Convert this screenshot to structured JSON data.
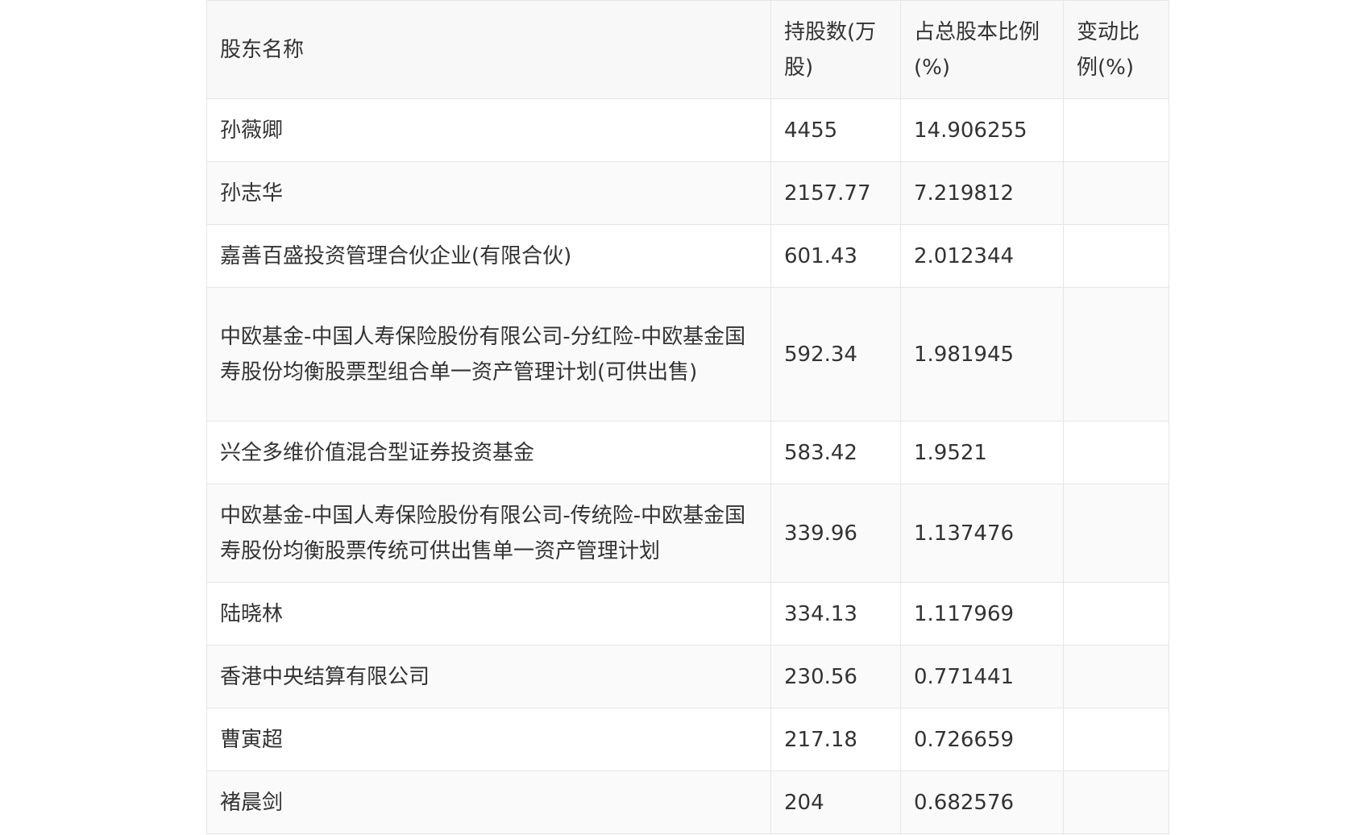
{
  "table": {
    "headers": {
      "name": "股东名称",
      "shares": "持股数(万股)",
      "ratio": "占总股本比例(%)",
      "change": "变动比例(%)"
    },
    "rows": [
      {
        "name": "孙薇卿",
        "shares": "4455",
        "ratio": "14.906255",
        "change": ""
      },
      {
        "name": "孙志华",
        "shares": "2157.77",
        "ratio": "7.219812",
        "change": ""
      },
      {
        "name": "嘉善百盛投资管理合伙企业(有限合伙)",
        "shares": "601.43",
        "ratio": "2.012344",
        "change": ""
      },
      {
        "name": "中欧基金-中国人寿保险股份有限公司-分红险-中欧基金国寿股份均衡股票型组合单一资产管理计划(可供出售)",
        "shares": "592.34",
        "ratio": "1.981945",
        "change": ""
      },
      {
        "name": "兴全多维价值混合型证券投资基金",
        "shares": "583.42",
        "ratio": "1.9521",
        "change": ""
      },
      {
        "name": "中欧基金-中国人寿保险股份有限公司-传统险-中欧基金国寿股份均衡股票传统可供出售单一资产管理计划",
        "shares": "339.96",
        "ratio": "1.137476",
        "change": ""
      },
      {
        "name": "陆晓林",
        "shares": "334.13",
        "ratio": "1.117969",
        "change": ""
      },
      {
        "name": "香港中央结算有限公司",
        "shares": "230.56",
        "ratio": "0.771441",
        "change": ""
      },
      {
        "name": "曹寅超",
        "shares": "217.18",
        "ratio": "0.726659",
        "change": ""
      },
      {
        "name": "褚晨剑",
        "shares": "204",
        "ratio": "0.682576",
        "change": ""
      }
    ]
  }
}
